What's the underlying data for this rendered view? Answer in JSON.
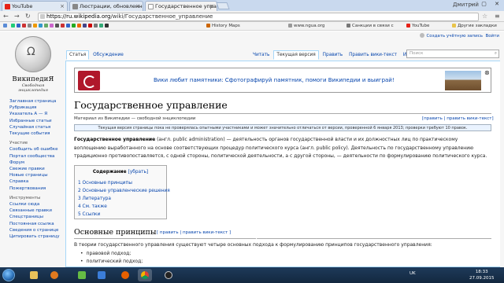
{
  "browser": {
    "tabs": [
      {
        "label": "YouTube",
        "active": false,
        "icon": "youtube-icon"
      },
      {
        "label": "Люстрации, обновленне",
        "active": false,
        "icon": "page-icon"
      },
      {
        "label": "Государственное управ",
        "active": true,
        "icon": "wikipedia-icon"
      }
    ],
    "user_label": "Дмитрий",
    "window_controls": "–  ▢  ✕",
    "address": {
      "host": "https://ru.wikipedia.org",
      "path": "/wiki/Государственное_управление"
    },
    "bookmarks": [
      {
        "label": "",
        "icon": "bookmark-icon"
      },
      {
        "label": "History Maps",
        "icon": "map-icon"
      },
      {
        "label": "www.ngua.org",
        "icon": "page-icon"
      },
      {
        "label": "Санкции в связи с",
        "icon": "page-icon"
      },
      {
        "label": "YouTube",
        "icon": "youtube-icon"
      },
      {
        "label": "Другие закладки",
        "icon": "folder-icon"
      }
    ]
  },
  "wiki": {
    "logo_title": "ВикипедиЯ",
    "logo_sub": "Свободная энциклопедия",
    "personal_link": "Создать учётную запись",
    "personal_login": "Войти",
    "left_tabs": [
      "Статья",
      "Обсуждение"
    ],
    "right_tabs": [
      "Читать",
      "Текущая версия",
      "Править",
      "Править вики-текст",
      "История"
    ],
    "search_placeholder": "Поиск",
    "sidebar_main": [
      "Заглавная страница",
      "Рубрикация",
      "Указатель А — Я",
      "Избранные статьи",
      "Случайная статья",
      "Текущие события"
    ],
    "sidebar_participation_title": "Участие",
    "sidebar_participation": [
      "Сообщить об ошибке",
      "Портал сообщества",
      "Форум",
      "Свежие правки",
      "Новые страницы",
      "Справка",
      "Пожертвования"
    ],
    "sidebar_tools_title": "Инструменты",
    "sidebar_tools": [
      "Ссылки сюда",
      "Связанные правки",
      "Спецстраницы",
      "Постоянная ссылка",
      "Сведения о странице",
      "Цитировать страницу"
    ],
    "banner_text": "Вики любит памятники: Сфотографируй памятник, помоги Википедии и выиграй!",
    "title": "Государственное управление",
    "subtitle": "Материал из Википедии — свободной энциклопедии",
    "edit_links": "[править | править вики-текст]",
    "notice": "Текущая версия страницы пока не проверялась опытными участниками и может значительно отличаться от версии, проверенной 6 января 2013; проверки требуют 10 правок.",
    "intro_bold": "Государственное управление",
    "intro_rest": " (англ. public administration) — деятельность органов государственной власти и их должностных лиц по практическому воплощению выработанного на основе соответствующих процедур политического курса (англ. public policy). Деятельность по государственному управлению традиционно противопоставляется, с одной стороны, политической деятельности, а с другой стороны, — деятельности по формулированию политического курса.",
    "toc_title": "Содержание",
    "toc_hide": "[убрать]",
    "toc_items": [
      "1 Основные принципы",
      "2 Основные управленческие решения",
      "3 Литература",
      "4 См. также",
      "5 Ссылки"
    ],
    "section_title": "Основные принципы",
    "section_edit": "[ править | править вики-текст ]",
    "section_text": "В теории государственного управления существуют четыре основных подхода к формулированию принципов государственного управления:",
    "bullets": [
      "правовой подход;",
      "политический подход;"
    ]
  },
  "taskbar": {
    "apps": [
      "windows-start-icon",
      "explorer-icon",
      "media-player-icon",
      "firefox-icon",
      "chrome-icon",
      "obs-icon"
    ],
    "tray_lang": "UK",
    "time": "18:33",
    "date": "27.09.2015"
  },
  "colors": {
    "link": "#0645ad",
    "tabstrip": "#c9d9ee",
    "taskbar": "#1e3a5a"
  }
}
